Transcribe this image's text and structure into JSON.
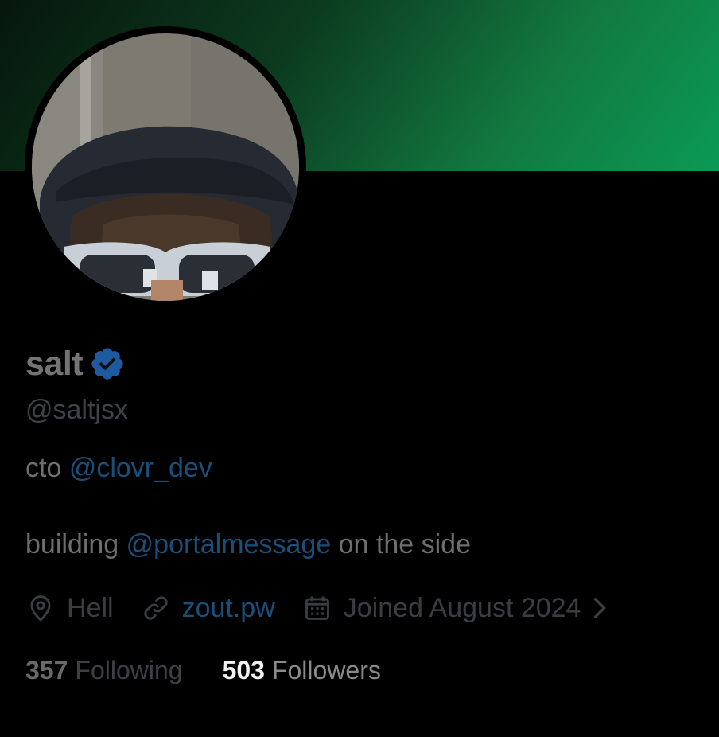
{
  "profile": {
    "display_name": "salt",
    "handle": "@saltjsx",
    "verified_icon": "verified-badge-icon",
    "avatar_alt": "profile photo"
  },
  "bio": {
    "line1": {
      "prefix": "cto ",
      "mention": "@clovr_dev"
    },
    "line2": {
      "prefix": "building ",
      "mention": "@portalmessage",
      "suffix": " on the side"
    }
  },
  "meta": {
    "location": {
      "icon": "location-pin-icon",
      "text": "Hell"
    },
    "website": {
      "icon": "link-icon",
      "text": "zout.pw"
    },
    "joined": {
      "icon": "calendar-icon",
      "text": "Joined August 2024",
      "chevron_icon": "chevron-right-icon"
    }
  },
  "stats": {
    "following": {
      "count": "357",
      "label": "Following"
    },
    "followers": {
      "count": "503",
      "label": "Followers"
    }
  },
  "colors": {
    "background": "#000000",
    "banner_dark": "#06170c",
    "banner_light": "#0a9a55",
    "link": "#1a4f7a",
    "verified": "#1d5aa0"
  }
}
